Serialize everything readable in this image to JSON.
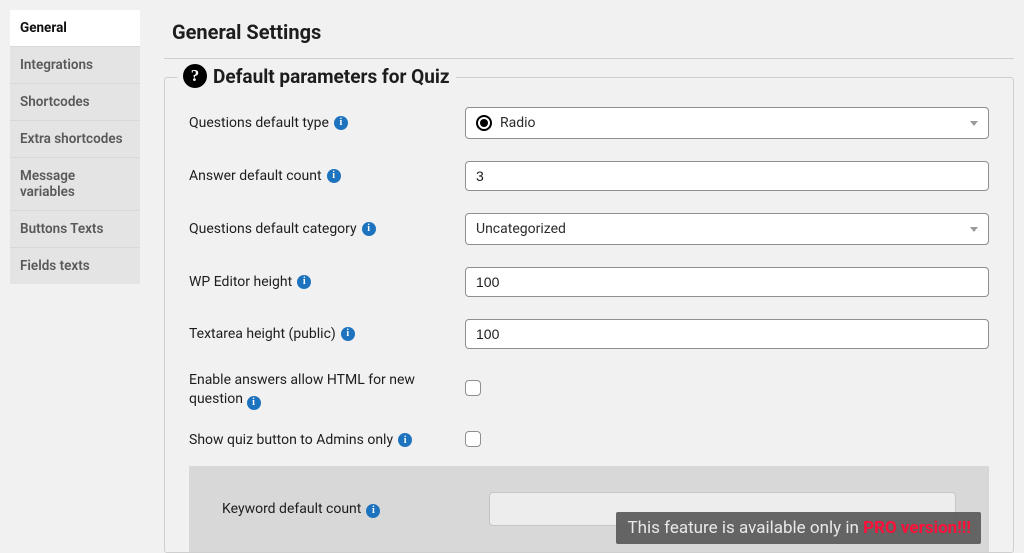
{
  "sidebar": {
    "items": [
      {
        "label": "General",
        "active": true
      },
      {
        "label": "Integrations"
      },
      {
        "label": "Shortcodes"
      },
      {
        "label": "Extra shortcodes"
      },
      {
        "label": "Message variables"
      },
      {
        "label": "Buttons Texts"
      },
      {
        "label": "Fields texts"
      }
    ]
  },
  "page": {
    "title": "General Settings"
  },
  "panel": {
    "title": "Default parameters for Quiz",
    "fields": {
      "question_type_label": "Questions default type",
      "question_type_value": "Radio",
      "answer_count_label": "Answer default count",
      "answer_count_value": "3",
      "category_label": "Questions default category",
      "category_value": "Uncategorized",
      "editor_height_label": "WP Editor height",
      "editor_height_value": "100",
      "textarea_height_label": "Textarea height (public)",
      "textarea_height_value": "100",
      "allow_html_label": "Enable answers allow HTML for new question",
      "admins_only_label": "Show quiz button to Admins only",
      "keyword_label": "Keyword default count"
    }
  },
  "pro_tip": {
    "prefix": "This feature is available only in ",
    "highlight": "PRO version!!!"
  }
}
